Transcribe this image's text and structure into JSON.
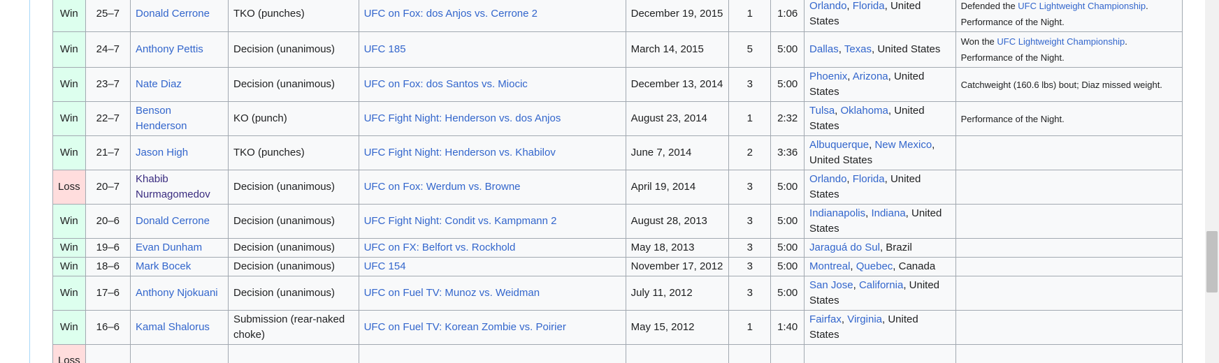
{
  "rows": [
    {
      "result": "Win",
      "record": "25–7",
      "opponent": "Donald Cerrone",
      "method": "TKO (punches)",
      "event": "UFC on Fox: dos Anjos vs. Cerrone 2",
      "date": "December 19, 2015",
      "round": "1",
      "time": "1:06",
      "loc_a": "Orlando",
      "loc_sep1": ", ",
      "loc_b": "Florida",
      "loc_rest": ", United States",
      "notes_pre": "Defended the ",
      "notes_link": "UFC Lightweight Championship",
      "notes_post": ". Performance of the Night."
    },
    {
      "result": "Win",
      "record": "24–7",
      "opponent": "Anthony Pettis",
      "method": "Decision (unanimous)",
      "event": "UFC 185",
      "date": "March 14, 2015",
      "round": "5",
      "time": "5:00",
      "loc_a": "Dallas",
      "loc_sep1": ", ",
      "loc_b": "Texas",
      "loc_rest": ", United States",
      "notes_pre": "Won the ",
      "notes_link": "UFC Lightweight Championship",
      "notes_post": ". Performance of the Night."
    },
    {
      "result": "Win",
      "record": "23–7",
      "opponent": "Nate Diaz",
      "method": "Decision (unanimous)",
      "event": "UFC on Fox: dos Santos vs. Miocic",
      "date": "December 13, 2014",
      "round": "3",
      "time": "5:00",
      "loc_a": "Phoenix",
      "loc_sep1": ", ",
      "loc_b": "Arizona",
      "loc_rest": ", United States",
      "notes_pre": "Catchweight (160.6 lbs) bout; Diaz missed weight.",
      "notes_link": "",
      "notes_post": ""
    },
    {
      "result": "Win",
      "record": "22–7",
      "opponent": "Benson Henderson",
      "method": "KO (punch)",
      "event": "UFC Fight Night: Henderson vs. dos Anjos",
      "date": "August 23, 2014",
      "round": "1",
      "time": "2:32",
      "loc_a": "Tulsa",
      "loc_sep1": ", ",
      "loc_b": "Oklahoma",
      "loc_rest": ", United States",
      "notes_pre": "Performance of the Night.",
      "notes_link": "",
      "notes_post": ""
    },
    {
      "result": "Win",
      "record": "21–7",
      "opponent": "Jason High",
      "method": "TKO (punches)",
      "event": "UFC Fight Night: Henderson vs. Khabilov",
      "date": "June 7, 2014",
      "round": "2",
      "time": "3:36",
      "loc_a": "Albuquerque",
      "loc_sep1": ", ",
      "loc_b": "New Mexico",
      "loc_rest": ", United States",
      "notes_pre": "",
      "notes_link": "",
      "notes_post": ""
    },
    {
      "result": "Loss",
      "record": "20–7",
      "opponent": "Khabib Nurmagomedov",
      "method": "Decision (unanimous)",
      "event": "UFC on Fox: Werdum vs. Browne",
      "date": "April 19, 2014",
      "round": "3",
      "time": "5:00",
      "loc_a": "Orlando",
      "loc_sep1": ", ",
      "loc_b": "Florida",
      "loc_rest": ", United States",
      "notes_pre": "",
      "notes_link": "",
      "notes_post": ""
    },
    {
      "result": "Win",
      "record": "20–6",
      "opponent": "Donald Cerrone",
      "method": "Decision (unanimous)",
      "event": "UFC Fight Night: Condit vs. Kampmann 2",
      "date": "August 28, 2013",
      "round": "3",
      "time": "5:00",
      "loc_a": "Indianapolis",
      "loc_sep1": ", ",
      "loc_b": "Indiana",
      "loc_rest": ", United States",
      "notes_pre": "",
      "notes_link": "",
      "notes_post": ""
    },
    {
      "result": "Win",
      "record": "19–6",
      "opponent": "Evan Dunham",
      "method": "Decision (unanimous)",
      "event": "UFC on FX: Belfort vs. Rockhold",
      "date": "May 18, 2013",
      "round": "3",
      "time": "5:00",
      "loc_a": "Jaraguá do Sul",
      "loc_sep1": "",
      "loc_b": "",
      "loc_rest": ", Brazil",
      "notes_pre": "",
      "notes_link": "",
      "notes_post": ""
    },
    {
      "result": "Win",
      "record": "18–6",
      "opponent": "Mark Bocek",
      "method": "Decision (unanimous)",
      "event": "UFC 154",
      "date": "November 17, 2012",
      "round": "3",
      "time": "5:00",
      "loc_a": "Montreal",
      "loc_sep1": ", ",
      "loc_b": "Quebec",
      "loc_rest": ", Canada",
      "notes_pre": "",
      "notes_link": "",
      "notes_post": ""
    },
    {
      "result": "Win",
      "record": "17–6",
      "opponent": "Anthony Njokuani",
      "method": "Decision (unanimous)",
      "event": "UFC on Fuel TV: Munoz vs. Weidman",
      "date": "July 11, 2012",
      "round": "3",
      "time": "5:00",
      "loc_a": "San Jose",
      "loc_sep1": ", ",
      "loc_b": "California",
      "loc_rest": ", United States",
      "notes_pre": "",
      "notes_link": "",
      "notes_post": ""
    },
    {
      "result": "Win",
      "record": "16–6",
      "opponent": "Kamal Shalorus",
      "method": "Submission (rear-naked choke)",
      "event": "UFC on Fuel TV: Korean Zombie vs. Poirier",
      "date": "May 15, 2012",
      "round": "1",
      "time": "1:40",
      "loc_a": "Fairfax",
      "loc_sep1": ", ",
      "loc_b": "Virginia",
      "loc_rest": ", United States",
      "notes_pre": "",
      "notes_link": "",
      "notes_post": ""
    },
    {
      "result": "Loss",
      "record": "",
      "opponent": "",
      "method": "",
      "event": "",
      "date": "",
      "round": "",
      "time": "",
      "loc_a": "",
      "loc_sep1": "",
      "loc_b": "",
      "loc_rest": "",
      "notes_pre": "",
      "notes_link": "",
      "notes_post": ""
    }
  ],
  "colors": {
    "win": "#ddffee",
    "loss": "#ffdddd",
    "link": "#3366cc",
    "visited_link": "#3a2c80",
    "border": "#a2a9b1"
  }
}
